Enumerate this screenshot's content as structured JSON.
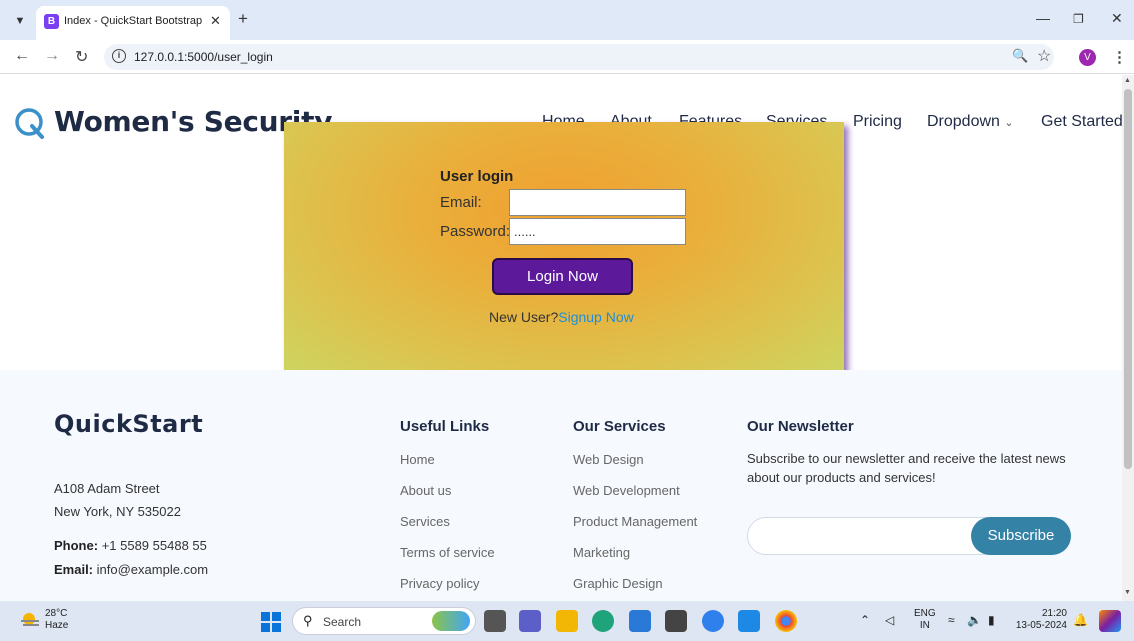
{
  "browser": {
    "tab_title": "Index - QuickStart Bootstrap Te",
    "tab_favicon": "B",
    "new_tab": "+",
    "url": "127.0.0.1:5000/user_login",
    "profile_initial": "V",
    "icons": [
      "tab-search-icon",
      "close-icon",
      "plus-icon",
      "minimize-icon",
      "restore-icon",
      "close-window-icon",
      "back-icon",
      "forward-icon",
      "reload-icon",
      "info-icon",
      "zoom-icon",
      "star-icon",
      "menu-icon"
    ]
  },
  "site": {
    "brand": "Women's Security",
    "nav": [
      "Home",
      "About",
      "Features",
      "Services",
      "Pricing",
      "Dropdown",
      "Get Started"
    ]
  },
  "login": {
    "title": "User login",
    "email_label": "Email:",
    "email_value": "",
    "password_label": "Password:",
    "password_value": "......",
    "button": "Login Now",
    "new_user": "New User?",
    "signup": "Signup Now",
    "accent": "#5c1a9a"
  },
  "footer": {
    "brand": "QuickStart",
    "address1": "A108 Adam Street",
    "address2": "New York, NY 535022",
    "phone_label": "Phone:",
    "phone": "+1 5589 55488 55",
    "email_label": "Email:",
    "email": "info@example.com",
    "useful_links_title": "Useful Links",
    "useful_links": [
      "Home",
      "About us",
      "Services",
      "Terms of service",
      "Privacy policy"
    ],
    "services_title": "Our Services",
    "services": [
      "Web Design",
      "Web Development",
      "Product Management",
      "Marketing",
      "Graphic Design"
    ],
    "newsletter_title": "Our Newsletter",
    "newsletter_text": "Subscribe to our newsletter and receive the latest news about our products and services!",
    "subscribe": "Subscribe",
    "accent": "#3482a6"
  },
  "taskbar": {
    "temp": "28°C",
    "weather": "Haze",
    "search": "Search",
    "lang1": "ENG",
    "lang2": "IN",
    "time": "21:20",
    "date": "13-05-2024"
  }
}
